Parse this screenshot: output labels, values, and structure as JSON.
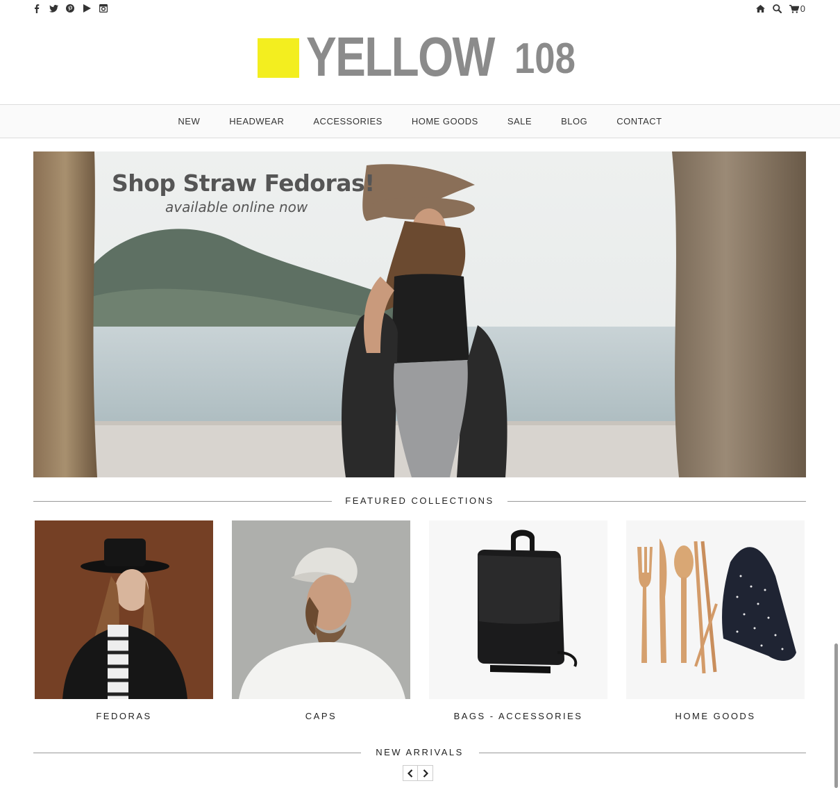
{
  "topbar": {
    "social": [
      "facebook-icon",
      "twitter-icon",
      "pinterest-icon",
      "youtube-icon",
      "instagram-icon"
    ],
    "cart_count": "0"
  },
  "logo": {
    "word": "YELLOW",
    "number": "108",
    "square_color": "#f3ee1f",
    "text_color": "#8b8b8b"
  },
  "nav": {
    "items": [
      "NEW",
      "HEADWEAR",
      "ACCESSORIES",
      "HOME GOODS",
      "SALE",
      "BLOG",
      "CONTACT"
    ]
  },
  "hero": {
    "title": "Shop Straw Fedoras!",
    "subtitle": "available online now"
  },
  "featured": {
    "heading": "FEATURED COLLECTIONS",
    "items": [
      {
        "label": "FEDORAS"
      },
      {
        "label": "CAPS"
      },
      {
        "label": "BAGS - ACCESSORIES"
      },
      {
        "label": "HOME GOODS"
      }
    ]
  },
  "new_arrivals": {
    "heading": "NEW ARRIVALS"
  }
}
